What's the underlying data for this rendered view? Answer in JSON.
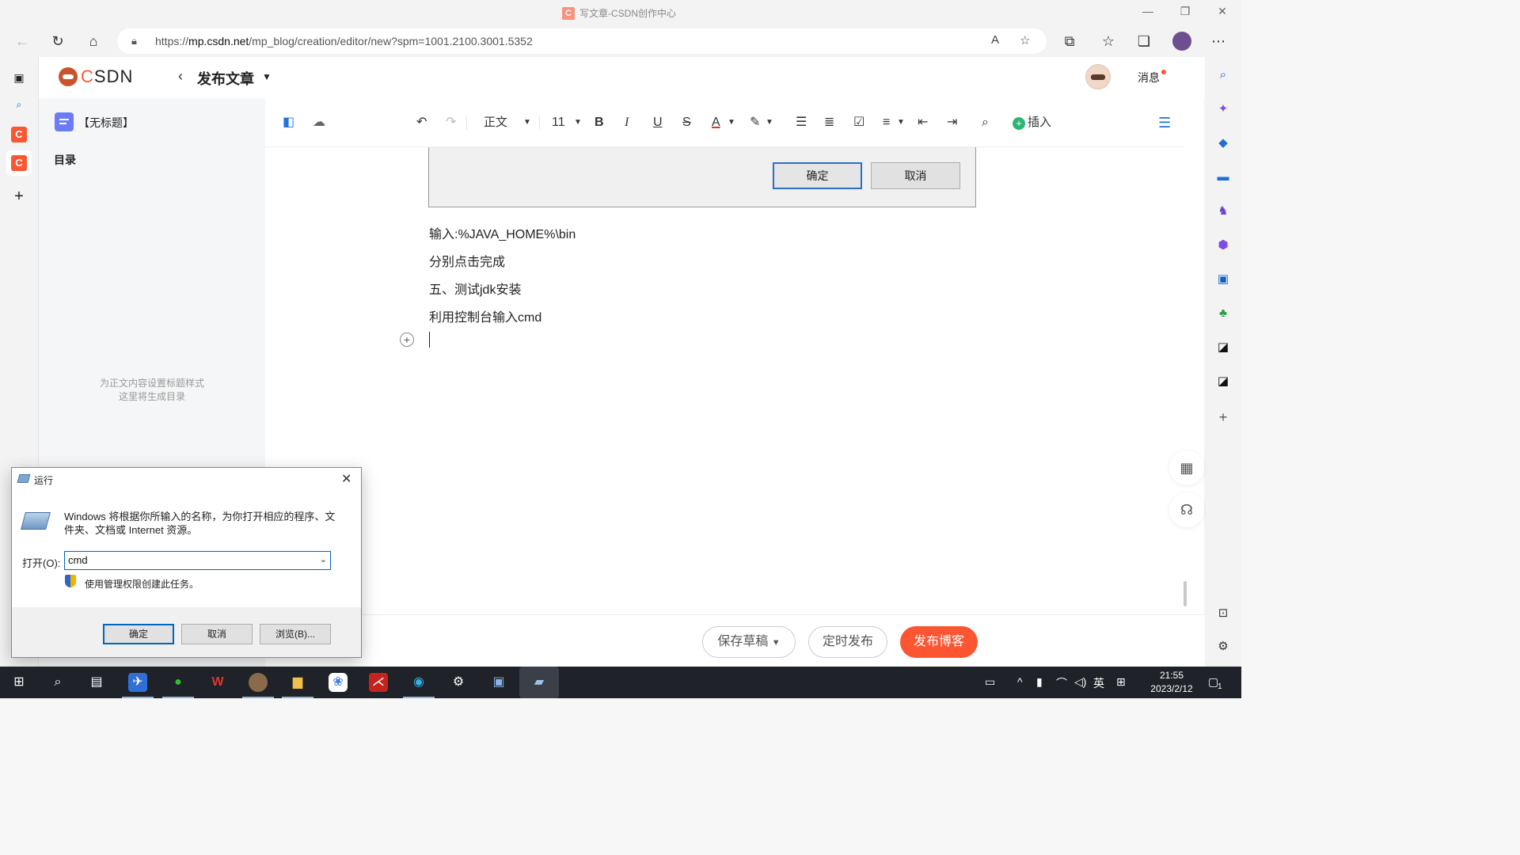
{
  "browser": {
    "tab_title": "写文章-CSDN创作中心",
    "url_prefix": "https://",
    "url_domain": "mp.csdn.net",
    "url_path": "/mp_blog/creation/editor/new?spm=1001.2100.3001.5352"
  },
  "csdn": {
    "logo_prefix": "C",
    "logo_rest": "SDN",
    "page_title": "发布文章",
    "messages_label": "消息"
  },
  "left_panel": {
    "doc_title": "【无标题】",
    "toc_heading": "目录",
    "toc_empty_line1": "为正文内容设置标题样式",
    "toc_empty_line2": "这里将生成目录"
  },
  "toolbar": {
    "paragraph_style": "正文",
    "font_size": "11",
    "insert_label": "插入"
  },
  "content": {
    "screenshot_ok": "确定",
    "screenshot_cancel": "取消",
    "paragraphs": [
      "输入:%JAVA_HOME%\\bin",
      "分别点击完成",
      "五、测试jdk安装",
      "利用控制台输入cmd"
    ]
  },
  "footer": {
    "save_draft": "保存草稿",
    "schedule": "定时发布",
    "publish": "发布博客"
  },
  "run_dialog": {
    "title": "运行",
    "description": "Windows 将根据你所输入的名称，为你打开相应的程序、文件夹、文档或 Internet 资源。",
    "open_label": "打开(O):",
    "input_value": "cmd",
    "admin_note": "使用管理权限创建此任务。",
    "ok": "确定",
    "cancel": "取消",
    "browse": "浏览(B)..."
  },
  "taskbar": {
    "time": "21:55",
    "date": "2023/2/12",
    "ime": "英",
    "notification_count": "1"
  },
  "colors": {
    "brand": "#fc5531",
    "insert_green": "#2bb673",
    "dialog_accent": "#0067c0"
  }
}
